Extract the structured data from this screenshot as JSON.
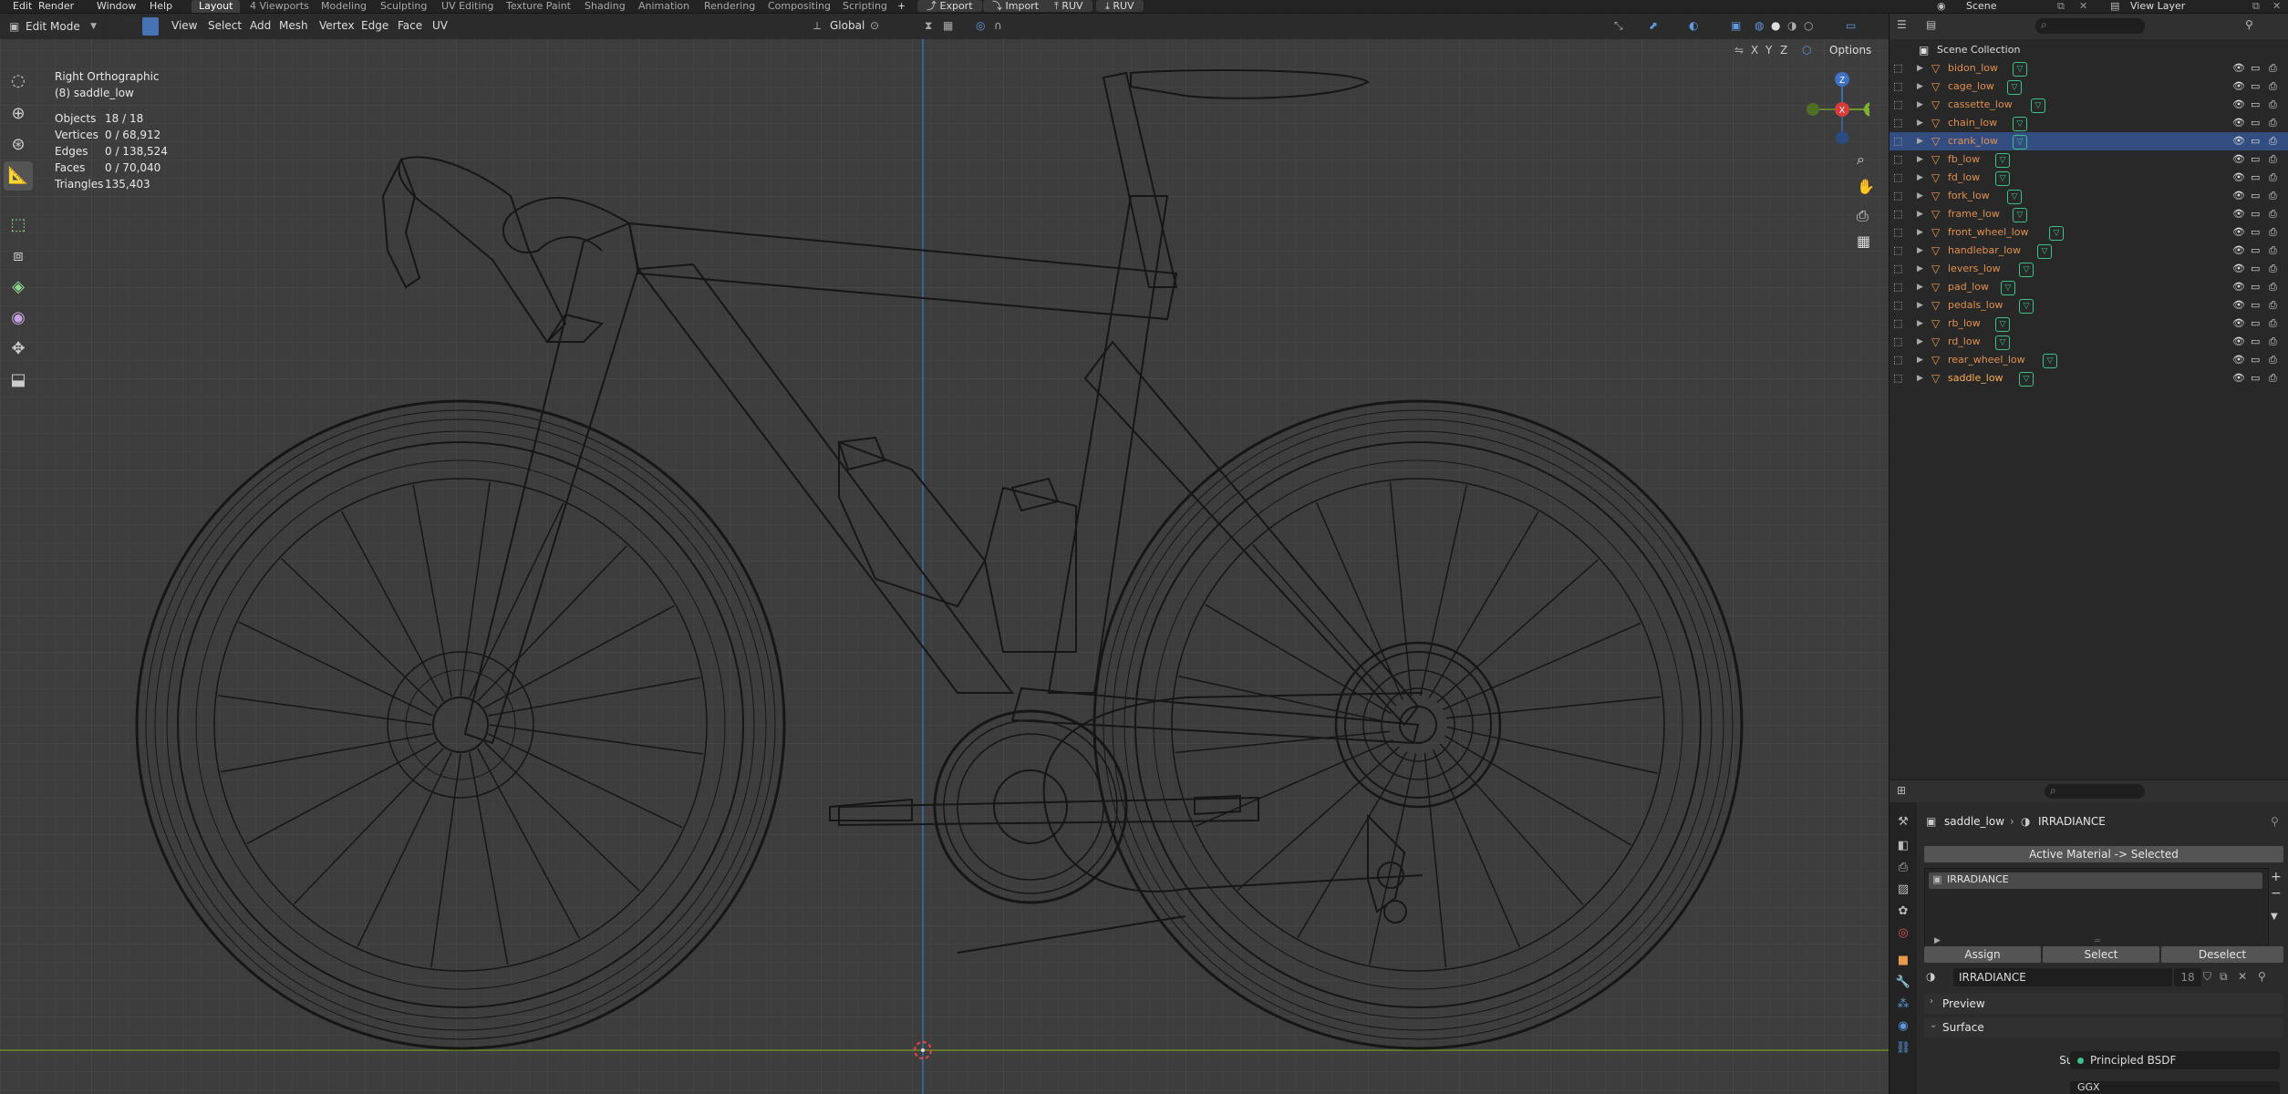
{
  "topbar": {
    "menus": [
      "Edit",
      "Render",
      "Window",
      "Help"
    ],
    "workspaces": [
      "Layout",
      "4 Viewports",
      "Modeling",
      "Sculpting",
      "UV Editing",
      "Texture Paint",
      "Shading",
      "Animation",
      "Rendering",
      "Compositing",
      "Scripting"
    ],
    "active_workspace": "Layout",
    "add_workspace": "+",
    "export_label": "Export",
    "import_label": "Import",
    "ruv1_label": "RUV",
    "ruv2_label": "RUV",
    "scene_label": "Scene",
    "view_layer_label": "View Layer"
  },
  "viewport": {
    "mode": "Edit Mode",
    "menus": [
      "View",
      "Select",
      "Add",
      "Mesh",
      "Vertex",
      "Edge",
      "Face",
      "UV"
    ],
    "transform_orientation": "Global",
    "axes_toggle": [
      "X",
      "Y",
      "Z"
    ],
    "options_label": "Options",
    "view_name": "Right Orthographic",
    "object_name": "(8) saddle_low",
    "stats": [
      {
        "label": "Objects",
        "value": "18 / 18"
      },
      {
        "label": "Vertices",
        "value": "0 / 68,912"
      },
      {
        "label": "Edges",
        "value": "0 / 138,524"
      },
      {
        "label": "Faces",
        "value": "0 / 70,040"
      },
      {
        "label": "Triangles",
        "value": "135,403"
      }
    ],
    "gizmo": {
      "z": "Z",
      "y": "Y",
      "x": "X"
    }
  },
  "outliner": {
    "collection": "Scene Collection",
    "items": [
      {
        "name": "bidon_low"
      },
      {
        "name": "cage_low"
      },
      {
        "name": "cassette_low"
      },
      {
        "name": "chain_low"
      },
      {
        "name": "crank_low"
      },
      {
        "name": "fb_low"
      },
      {
        "name": "fd_low"
      },
      {
        "name": "fork_low"
      },
      {
        "name": "frame_low"
      },
      {
        "name": "front_wheel_low"
      },
      {
        "name": "handlebar_low"
      },
      {
        "name": "levers_low"
      },
      {
        "name": "pad_low"
      },
      {
        "name": "pedals_low"
      },
      {
        "name": "rb_low"
      },
      {
        "name": "rd_low"
      },
      {
        "name": "rear_wheel_low"
      },
      {
        "name": "saddle_low"
      }
    ],
    "selected_index": 4,
    "active_index": 17
  },
  "properties": {
    "breadcrumb_object": "saddle_low",
    "breadcrumb_material": "IRRADIANCE",
    "active_material_button": "Active Material -> Selected",
    "slot_name": "IRRADIANCE",
    "assign": "Assign",
    "select": "Select",
    "deselect": "Deselect",
    "material_name": "IRRADIANCE",
    "user_count": "18",
    "preview_label": "Preview",
    "surface_label": "Surface",
    "surface_field_label": "Surface",
    "surface_shader": "Principled BSDF",
    "distribution": "GGX"
  },
  "colors": {
    "accent": "#4772b3",
    "outliner_selected": "#334d80",
    "object_orange": "#e09050",
    "modifier_green": "#3cc28a",
    "wire": "#151515",
    "viewport_bg": "#3f3f3f"
  }
}
